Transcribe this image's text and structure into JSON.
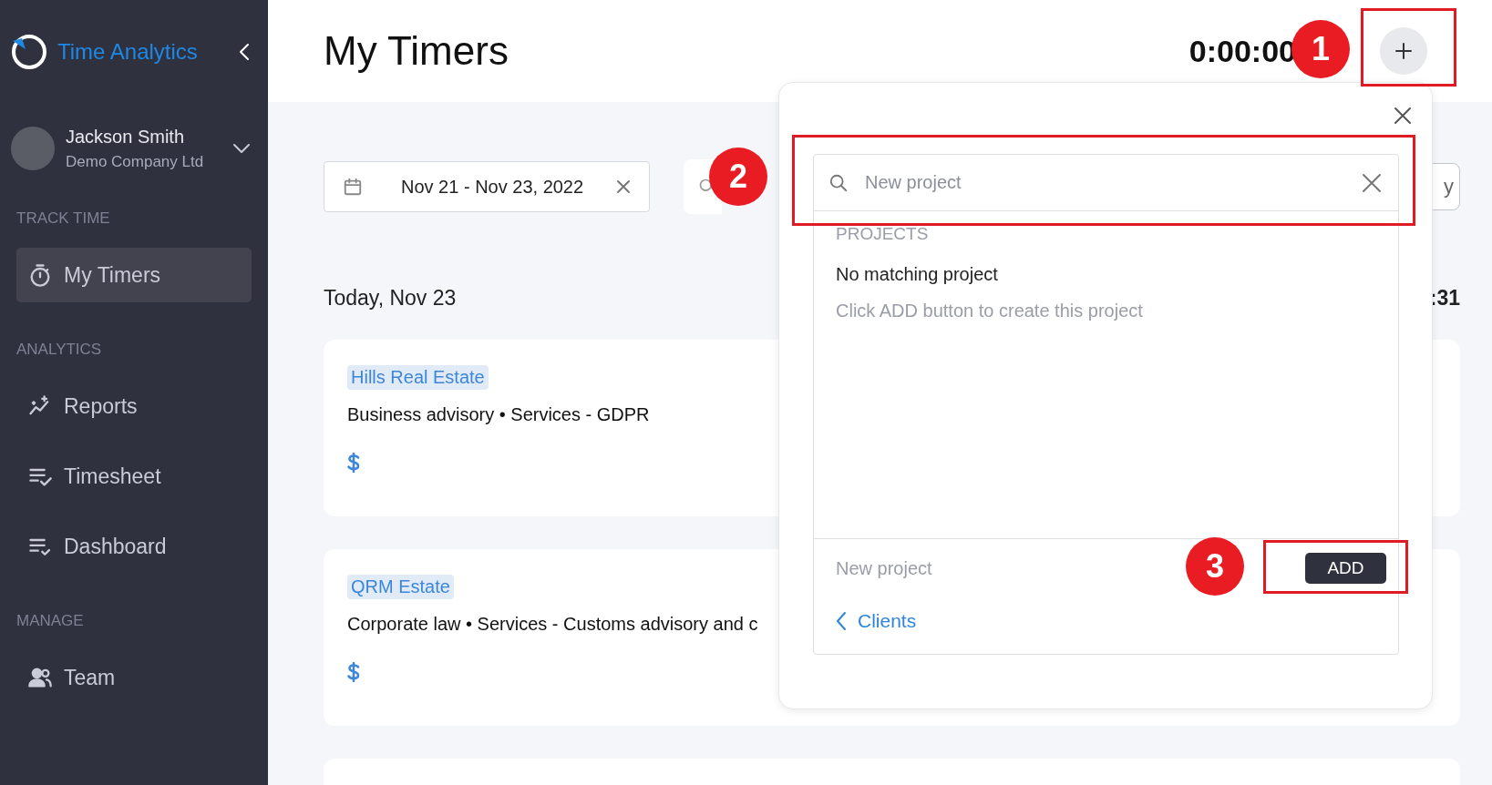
{
  "sidebar": {
    "app_name": "Time Analytics",
    "user": {
      "name": "Jackson Smith",
      "company": "Demo Company Ltd"
    },
    "sections": [
      {
        "title": "TRACK TIME",
        "items": [
          {
            "label": "My Timers",
            "kind": "timer",
            "selected": true
          }
        ]
      },
      {
        "title": "ANALYTICS",
        "items": [
          {
            "label": "Reports",
            "kind": "reports",
            "selected": false
          },
          {
            "label": "Timesheet",
            "kind": "timesheet",
            "selected": false
          },
          {
            "label": "Dashboard",
            "kind": "dashboard",
            "selected": false
          }
        ]
      },
      {
        "title": "MANAGE",
        "items": [
          {
            "label": "Team",
            "kind": "team",
            "selected": false
          }
        ]
      }
    ]
  },
  "header": {
    "title": "My Timers",
    "timer": "0:00:00"
  },
  "filters": {
    "date_range": "Nov 21 - Nov 23, 2022",
    "right_button": "y"
  },
  "day": {
    "heading": "Today, Nov 23",
    "total": ":31"
  },
  "entries": [
    {
      "client": "Hills Real Estate",
      "description": "Business advisory • Services - GDPR"
    },
    {
      "client": "QRM Estate",
      "description": "Corporate law • Services - Customs advisory and c"
    }
  ],
  "popup": {
    "search_placeholder": "New project",
    "section_label": "PROJECTS",
    "empty_title": "No matching project",
    "empty_hint": "Click ADD button to create this project",
    "new_label": "New project",
    "add_button": "ADD",
    "back_link": "Clients"
  },
  "annotations": [
    {
      "number": "1"
    },
    {
      "number": "2"
    },
    {
      "number": "3"
    }
  ]
}
